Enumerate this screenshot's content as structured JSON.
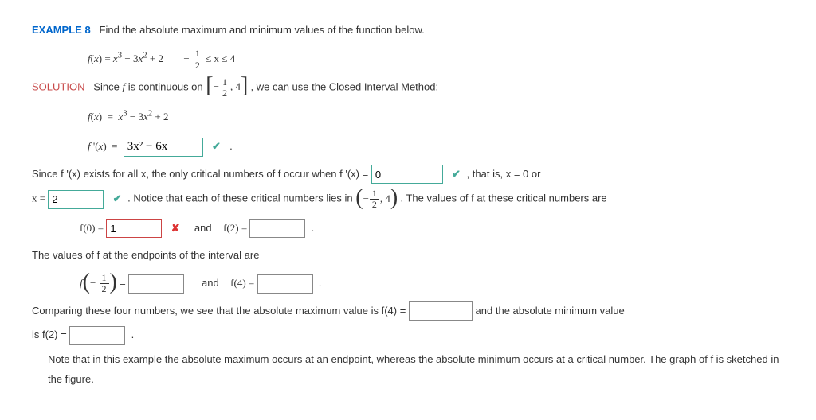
{
  "example_label": "EXAMPLE 8",
  "example_title": "Find the absolute maximum and minimum values of the function below.",
  "function_def": "f(x) = x³ − 3x² + 2",
  "domain_text_parts": {
    "leq1": "≤ x ≤",
    "right": "4",
    "neg": "−"
  },
  "solution_label": "SOLUTION",
  "solution_line1_a": "Since ",
  "solution_line1_b": " is continuous on ",
  "solution_line1_c": ", we can use the Closed Interval Method:",
  "func_line": "f(x)  =  x³ − 3x² + 2",
  "fprime_label": "f '(x)  =",
  "answers": {
    "fprime": "3x² − 6x",
    "zero": "0",
    "two": "2",
    "f0": "1",
    "f2": "",
    "fneg": "",
    "f4": "",
    "f4max": "",
    "f2min": ""
  },
  "line_exists_a": "Since  f '(x)  exists for all x, the only critical numbers of f occur when  f '(x) = ",
  "line_exists_b": ",  that is,  x = 0  or",
  "x_eq": "x = ",
  "notice_a": ".  Notice that each of these critical numbers lies in  ",
  "notice_b": ".  The values of f at these critical numbers are",
  "f0_label": "f(0) = ",
  "and": "and",
  "f2_label": "f(2) = ",
  "endpoints_line": "The values of f at the endpoints of the interval are",
  "fneg_eq": " = ",
  "f4_label": "f(4) = ",
  "compare_a": "Comparing these four numbers, we see that the absolute maximum value is  f(4) = ",
  "compare_b": " and the absolute minimum value",
  "compare_c": "is  f(2) = ",
  "note": "Note that in this example the absolute maximum occurs at an endpoint, whereas the absolute minimum occurs at a critical number. The graph of f is sketched in the figure.",
  "period": "."
}
